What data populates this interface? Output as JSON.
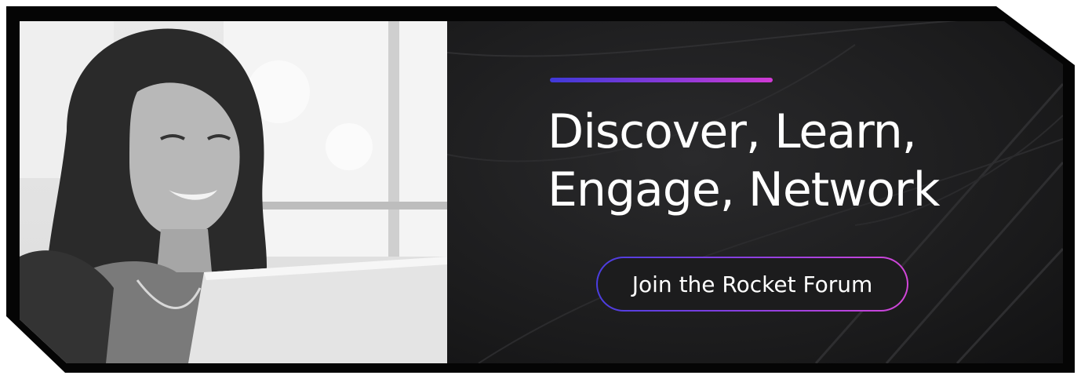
{
  "banner": {
    "headline_line1": "Discover, Learn,",
    "headline_line2": "Engage, Network",
    "cta_label": "Join the Rocket Forum"
  },
  "colors": {
    "frame": "#050505",
    "panel": "#1a1a1b",
    "accent_start": "#3f39d8",
    "accent_end": "#d03ad4",
    "text": "#ffffff"
  },
  "photo": {
    "subject": "smiling woman using laptop",
    "style": "black-and-white"
  }
}
